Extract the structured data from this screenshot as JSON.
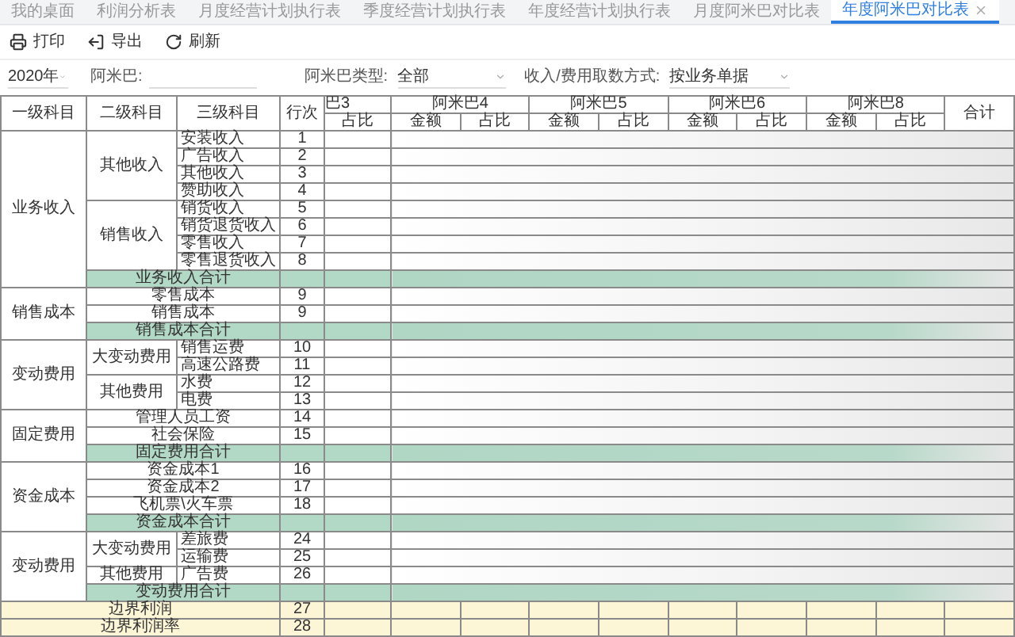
{
  "tabs": [
    {
      "label": "我的桌面",
      "selected": false,
      "closable": false
    },
    {
      "label": "利润分析表",
      "selected": false,
      "closable": false
    },
    {
      "label": "月度经营计划执行表",
      "selected": false,
      "closable": false
    },
    {
      "label": "季度经营计划执行表",
      "selected": false,
      "closable": false
    },
    {
      "label": "年度经营计划执行表",
      "selected": false,
      "closable": false
    },
    {
      "label": "月度阿米巴对比表",
      "selected": false,
      "closable": false
    },
    {
      "label": "年度阿米巴对比表",
      "selected": true,
      "closable": true
    }
  ],
  "toolbar": [
    {
      "kind": "print",
      "label": "打印"
    },
    {
      "kind": "export",
      "label": "导出"
    },
    {
      "kind": "refresh",
      "label": "刷新"
    }
  ],
  "filters": {
    "year": "2020年",
    "amoeba_label": "阿米巴:",
    "type_label": "阿米巴类型:",
    "type_value": "全部",
    "method_label": "收入/费用取数方式:",
    "method_value": "按业务单据"
  },
  "table": {
    "columns": [
      "一级科目",
      "二级科目",
      "三级科目",
      "行次"
    ],
    "first_group": {
      "name": "巴3",
      "sub": "占比"
    },
    "groups": [
      {
        "name": "阿米巴4",
        "subs": [
          "金额",
          "占比"
        ]
      },
      {
        "name": "阿米巴5",
        "subs": [
          "金额",
          "占比"
        ]
      },
      {
        "name": "阿米巴6",
        "subs": [
          "金额",
          "占比"
        ]
      },
      {
        "name": "阿米巴8",
        "subs": [
          "金额",
          "占比"
        ]
      }
    ],
    "total_column": "合计",
    "sections": [
      {
        "name": "业务收入",
        "total": "业务收入合计",
        "children": [
          {
            "name": "其他收入",
            "children": [
              {
                "name": "安装收入",
                "line": "1"
              },
              {
                "name": "广告收入",
                "line": "2"
              },
              {
                "name": "其他收入",
                "line": "3"
              },
              {
                "name": "赞助收入",
                "line": "4"
              }
            ]
          },
          {
            "name": "销售收入",
            "children": [
              {
                "name": "销货收入",
                "line": "5"
              },
              {
                "name": "销货退货收入",
                "line": "6"
              },
              {
                "name": "零售收入",
                "line": "7"
              },
              {
                "name": "零售退货收入",
                "line": "8"
              }
            ]
          }
        ]
      },
      {
        "name": "销售成本",
        "total": "销售成本合计",
        "children": [
          {
            "name": "零售成本",
            "line": "9"
          },
          {
            "name": "销售成本",
            "line": "9"
          }
        ]
      },
      {
        "name": "变动费用",
        "children": [
          {
            "name": "大变动费用",
            "children": [
              {
                "name": "销售运费",
                "line": "10"
              },
              {
                "name": "高速公路费",
                "line": "11"
              }
            ]
          },
          {
            "name": "其他费用",
            "children": [
              {
                "name": "水费",
                "line": "12"
              },
              {
                "name": "电费",
                "line": "13"
              }
            ]
          }
        ]
      },
      {
        "name": "固定费用",
        "total": "固定费用合计",
        "children": [
          {
            "name": "管理人员工资",
            "line": "14"
          },
          {
            "name": "社会保险",
            "line": "15"
          }
        ]
      },
      {
        "name": "资金成本",
        "total": "资金成本合计",
        "children": [
          {
            "name": "资金成本1",
            "line": "16"
          },
          {
            "name": "资金成本2",
            "line": "17"
          },
          {
            "name": "飞机票\\火车票",
            "line": "18"
          }
        ]
      },
      {
        "name": "变动费用",
        "total": "变动费用合计",
        "children": [
          {
            "name": "大变动费用",
            "children": [
              {
                "name": "差旅费",
                "line": "24"
              },
              {
                "name": "运输费",
                "line": "25"
              }
            ]
          },
          {
            "name": "其他费用",
            "children": [
              {
                "name": "广告费",
                "line": "26"
              }
            ]
          }
        ]
      }
    ],
    "summary_rows": [
      {
        "label": "边界利润",
        "line": "27"
      },
      {
        "label": "边界利润率",
        "line": "28"
      }
    ]
  }
}
